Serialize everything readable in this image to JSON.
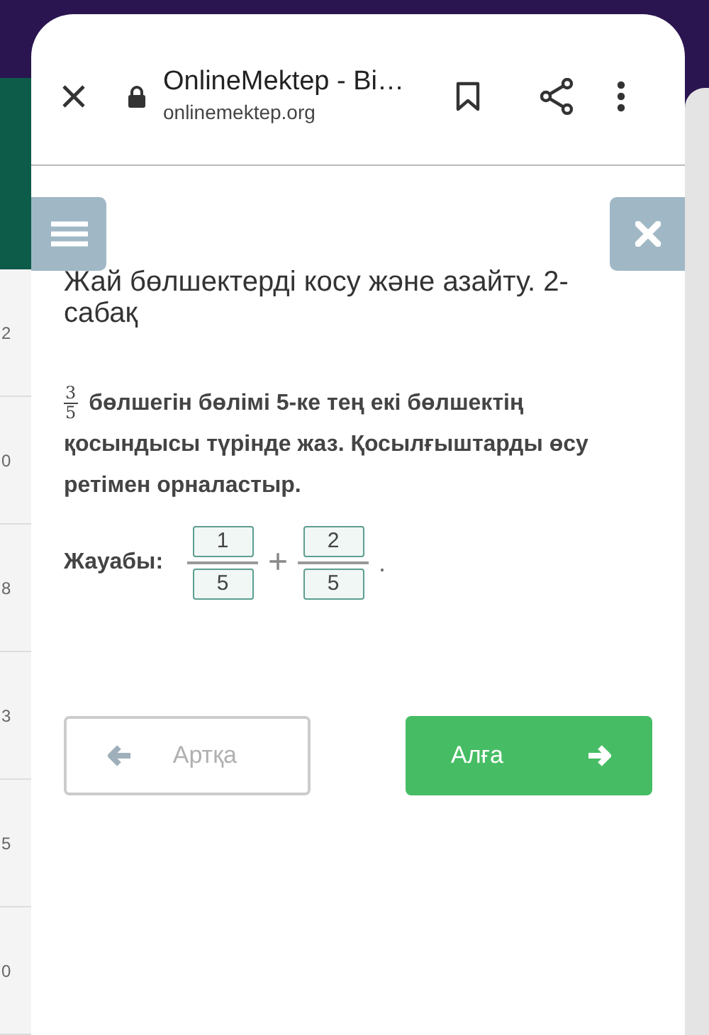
{
  "left_card": {
    "labels": [
      "2",
      "0",
      "8",
      "3",
      "5",
      "0"
    ]
  },
  "browser": {
    "title": "OnlineMektep - Bi…",
    "url": "onlinemektep.org"
  },
  "lesson": {
    "title": "Жай бөлшектерді косу және азайту. 2-сабақ",
    "problem": {
      "fraction": {
        "numerator": "3",
        "denominator": "5"
      },
      "text": "бөлшегін бөлімі 5-ке тең екі бөлшектің қосындысы түрінде жаз. Қосылғыштарды өсу ретімен орналастыр."
    },
    "answer": {
      "label": "Жауабы:",
      "fractions": [
        {
          "numerator": "1",
          "denominator": "5"
        },
        {
          "numerator": "2",
          "denominator": "5"
        }
      ],
      "operator": "+",
      "end": "."
    }
  },
  "nav": [
    {
      "kind": "back",
      "label": "Артқа",
      "disabled": true
    },
    {
      "kind": "next",
      "label": "Алға",
      "disabled": false
    }
  ]
}
